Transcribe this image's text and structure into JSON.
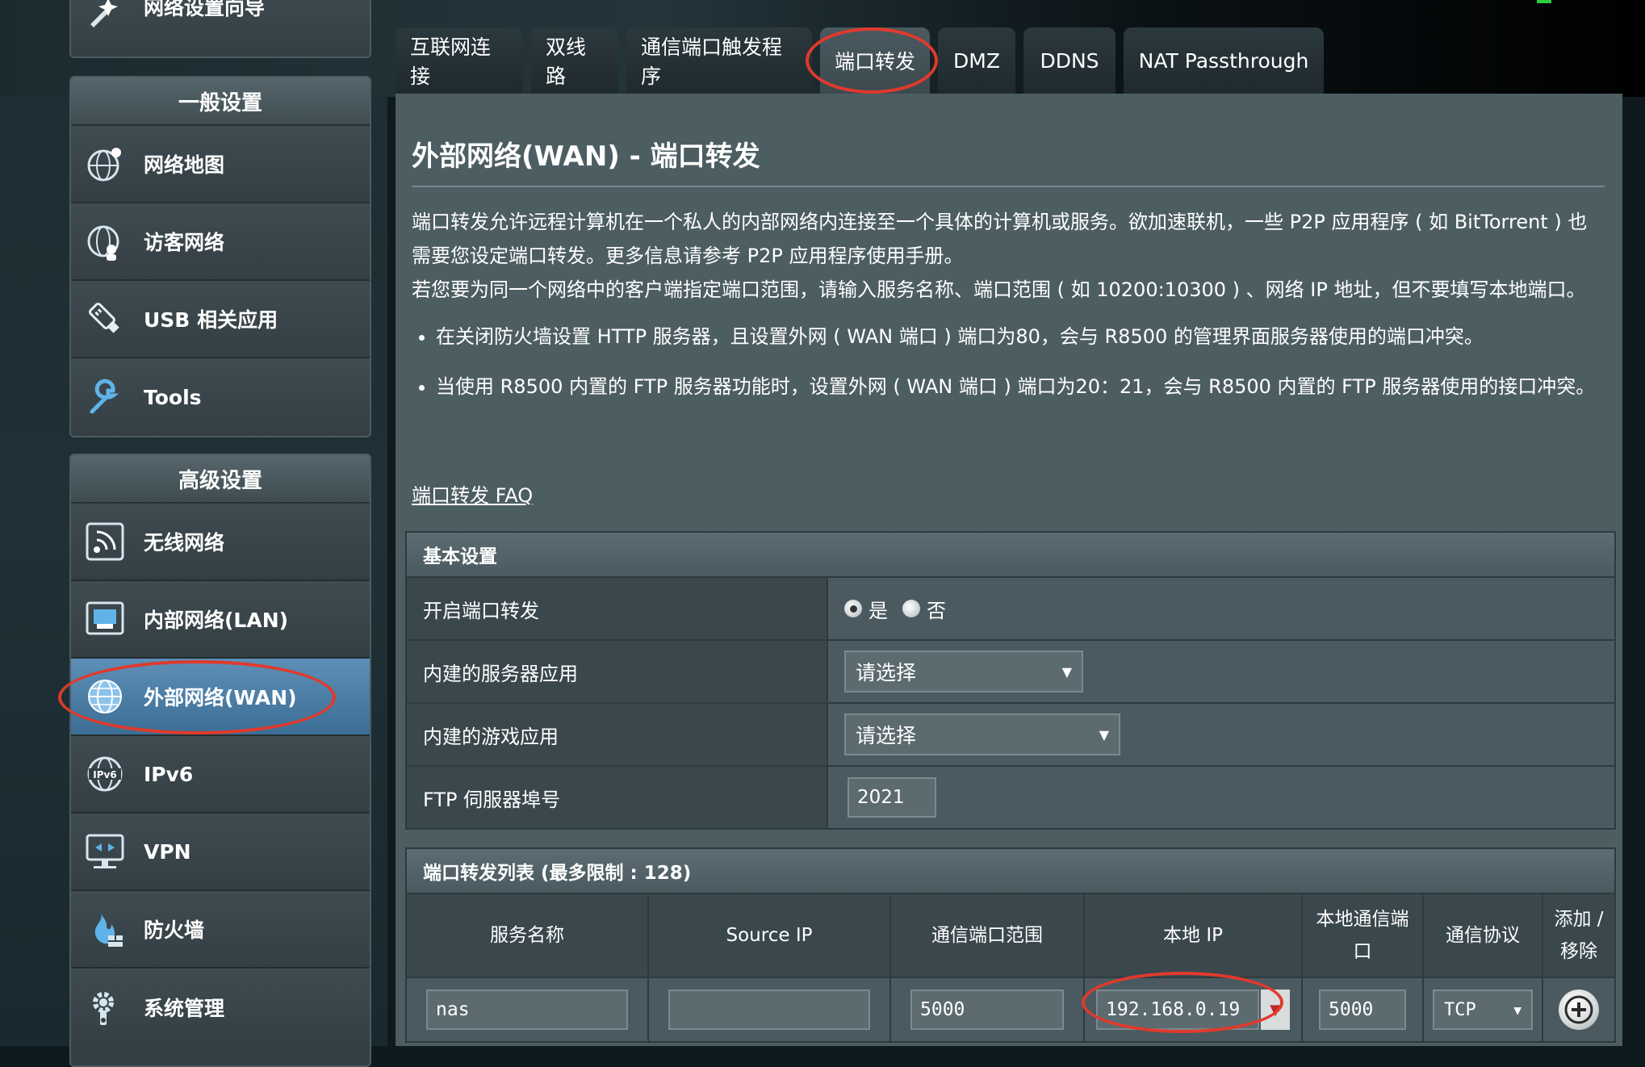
{
  "sidebar": {
    "top_item": {
      "label": "网络设置向导",
      "icon": "wizard-icon"
    },
    "general": {
      "header": "一般设置",
      "items": [
        {
          "label": "网络地图",
          "icon": "network-map-icon"
        },
        {
          "label": "访客网络",
          "icon": "guest-network-icon"
        },
        {
          "label": "USB 相关应用",
          "icon": "usb-icon"
        },
        {
          "label": "Tools",
          "icon": "wrench-icon"
        }
      ]
    },
    "advanced": {
      "header": "高级设置",
      "items": [
        {
          "label": "无线网络",
          "icon": "wireless-icon"
        },
        {
          "label": "内部网络(LAN)",
          "icon": "lan-icon"
        },
        {
          "label": "外部网络(WAN)",
          "icon": "globe-icon"
        },
        {
          "label": "IPv6",
          "icon": "ipv6-icon"
        },
        {
          "label": "VPN",
          "icon": "vpn-icon"
        },
        {
          "label": "防火墙",
          "icon": "firewall-icon"
        },
        {
          "label": "系统管理",
          "icon": "gear-icon"
        }
      ]
    }
  },
  "tabs": [
    {
      "label": "互联网连接"
    },
    {
      "label": "双线路"
    },
    {
      "label": "通信端口触发程序"
    },
    {
      "label": "端口转发"
    },
    {
      "label": "DMZ"
    },
    {
      "label": "DDNS"
    },
    {
      "label": "NAT Passthrough"
    }
  ],
  "page": {
    "title": "外部网络(WAN) - 端口转发",
    "desc_1": "端口转发允许远程计算机在一个私人的内部网络内连接至一个具体的计算机或服务。欲加速联机，一些 P2P 应用程序 ( 如 BitTorrent ) 也需要您设定端口转发。更多信息请参考 P2P 应用程序使用手册。",
    "desc_2": "若您要为同一个网络中的客户端指定端口范围，请输入服务名称、端口范围 ( 如 10200:10300 ) 、网络 IP 地址，但不要填写本地端口。",
    "bullet_1": "在关闭防火墙设置 HTTP 服务器，且设置外网 ( WAN 端口 ) 端口为80，会与 R8500 的管理界面服务器使用的端口冲突。",
    "bullet_2": "当使用 R8500 内置的 FTP 服务器功能时，设置外网 ( WAN 端口 ) 端口为20：21，会与 R8500 内置的 FTP 服务器使用的接口冲突。",
    "faq_link": "端口转发 FAQ"
  },
  "basic": {
    "header": "基本设置",
    "enable_label": "开启端口转发",
    "yes": "是",
    "no": "否",
    "enabled": "是",
    "server_app_label": "内建的服务器应用",
    "server_app_value": "请选择",
    "game_app_label": "内建的游戏应用",
    "game_app_value": "请选择",
    "ftp_label": "FTP 伺服器埠号",
    "ftp_value": "2021"
  },
  "forward_list": {
    "header": "端口转发列表 (最多限制 :  128)",
    "columns": [
      "服务名称",
      "Source IP",
      "通信端口范围",
      "本地 IP",
      "本地通信端口",
      "通信协议",
      "添加 / 移除"
    ],
    "row": {
      "service_name": "nas",
      "source_ip": "",
      "port_range": "5000",
      "local_ip": "192.168.0.19",
      "local_port": "5000",
      "protocol": "TCP",
      "add_icon": "plus-circle-icon"
    }
  },
  "colors": {
    "panel": "#4d5e63",
    "sidebar_active": "#3c6d95",
    "annotation_ring": "#e03a2c"
  }
}
